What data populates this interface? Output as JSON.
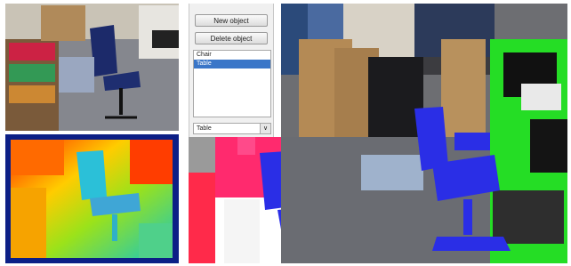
{
  "tool": {
    "new_object_label": "New object",
    "delete_object_label": "Delete object",
    "objects": [
      {
        "label": "Chair",
        "selected": false
      },
      {
        "label": "Table",
        "selected": true
      }
    ],
    "class_select_value": "Table",
    "chevron_glyph": "∨"
  },
  "colors": {
    "chair_label": "#2a2ee6",
    "table_label": "#22dd22",
    "wall_label": "#ff1f6e",
    "selection": "#3a76c8"
  }
}
